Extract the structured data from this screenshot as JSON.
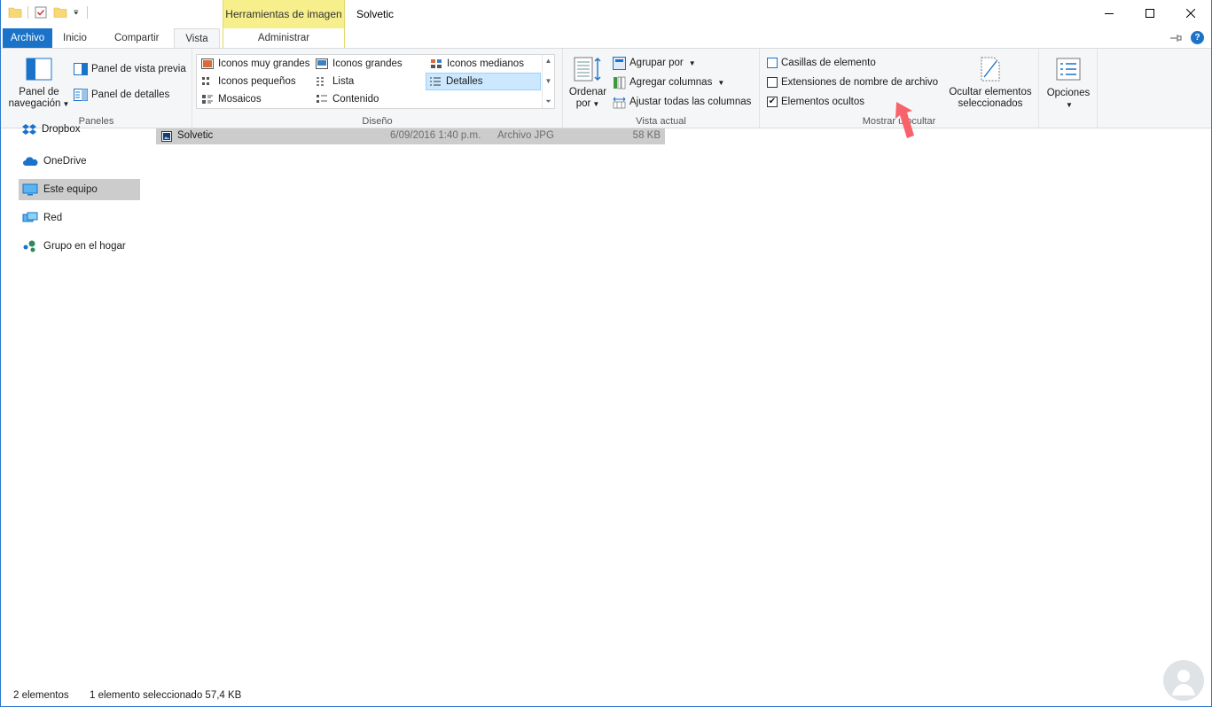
{
  "titlebar": {
    "contextual_tab": "Herramientas de imagen",
    "window_title": "Solvetic"
  },
  "tabs": {
    "file": "Archivo",
    "home": "Inicio",
    "share": "Compartir",
    "view": "Vista",
    "manage": "Administrar"
  },
  "ribbon": {
    "panes": {
      "label": "Paneles",
      "nav_pane_line1": "Panel de",
      "nav_pane_line2": "navegación",
      "preview_pane": "Panel de vista previa",
      "details_pane": "Panel de detalles"
    },
    "layout": {
      "label": "Diseño",
      "items": [
        "Iconos muy grandes",
        "Iconos grandes",
        "Iconos medianos",
        "Iconos pequeños",
        "Lista",
        "Detalles",
        "Mosaicos",
        "Contenido"
      ],
      "selected": "Detalles"
    },
    "current_view": {
      "label": "Vista actual",
      "sort_line1": "Ordenar",
      "sort_line2": "por",
      "group_by": "Agrupar por",
      "add_columns": "Agregar columnas",
      "size_columns": "Ajustar todas las columnas"
    },
    "show_hide": {
      "label": "Mostrar u ocultar",
      "item_checkboxes": "Casillas de elemento",
      "item_checkboxes_checked": false,
      "file_extensions": "Extensiones de nombre de archivo",
      "file_extensions_checked": false,
      "hidden_items": "Elementos ocultos",
      "hidden_items_checked": true,
      "hide_selected_line1": "Ocultar elementos",
      "hide_selected_line2": "seleccionados"
    },
    "options": {
      "label": "Opciones"
    }
  },
  "navpane": {
    "items": [
      "Dropbox",
      "OneDrive",
      "Este equipo",
      "Red",
      "Grupo en el hogar"
    ],
    "selected": "Este equipo"
  },
  "files": [
    {
      "name": "Solvetic",
      "date": "6/09/2016 1:40 p.m.",
      "type": "Archivo JPG",
      "size": "58 KB"
    }
  ],
  "statusbar": {
    "count": "2 elementos",
    "selection": "1 elemento seleccionado  57,4 KB"
  },
  "colors": {
    "accent": "#1a73c8",
    "contextual": "#f6ef8c",
    "selection": "#cccccc",
    "arrow": "#f8636b"
  }
}
